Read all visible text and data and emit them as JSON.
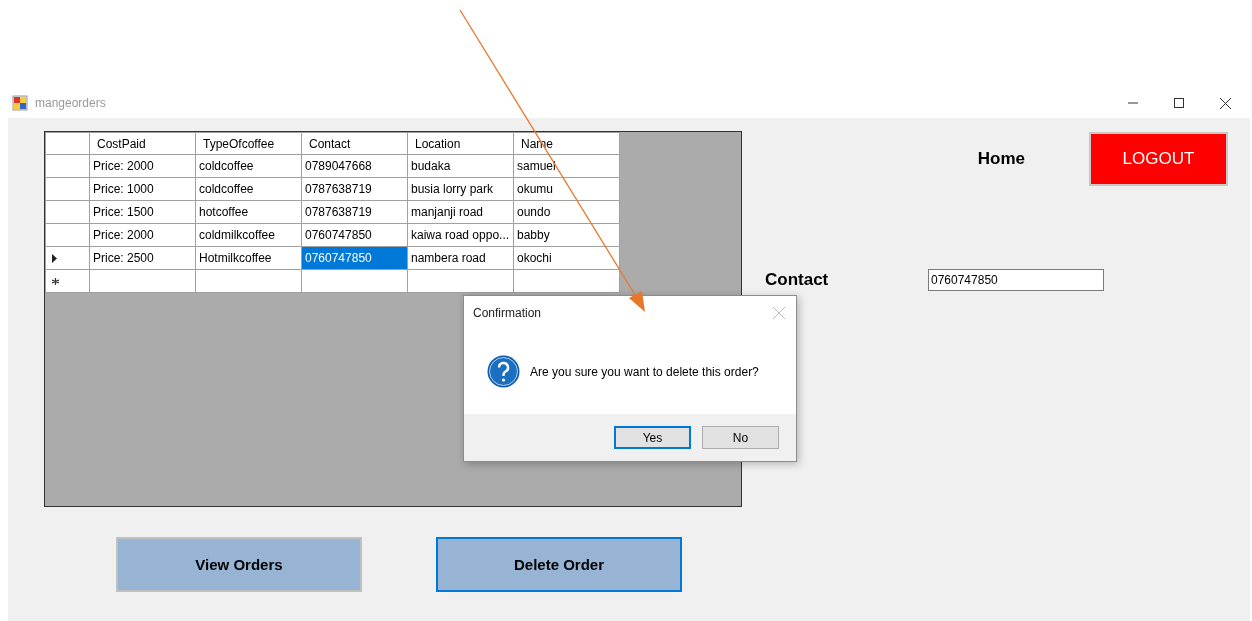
{
  "window": {
    "title": "mangeorders"
  },
  "table": {
    "columns": [
      "CostPaid",
      "TypeOfcoffee",
      "Contact",
      "Location",
      "Name"
    ],
    "rows": [
      {
        "current": false,
        "cells": [
          {
            "text": "Price: 2000",
            "selected": false
          },
          {
            "text": "coldcoffee",
            "selected": false
          },
          {
            "text": "0789047668",
            "selected": false
          },
          {
            "text": "budaka",
            "selected": false
          },
          {
            "text": "samuel",
            "selected": false
          }
        ]
      },
      {
        "current": false,
        "cells": [
          {
            "text": "Price: 1000",
            "selected": false
          },
          {
            "text": "coldcoffee",
            "selected": false
          },
          {
            "text": "0787638719",
            "selected": false
          },
          {
            "text": "busia lorry park",
            "selected": false
          },
          {
            "text": "okumu",
            "selected": false
          }
        ]
      },
      {
        "current": false,
        "cells": [
          {
            "text": "Price: 1500",
            "selected": false
          },
          {
            "text": "hotcoffee",
            "selected": false
          },
          {
            "text": "0787638719",
            "selected": false
          },
          {
            "text": "manjanji road",
            "selected": false
          },
          {
            "text": "oundo",
            "selected": false
          }
        ]
      },
      {
        "current": false,
        "cells": [
          {
            "text": "Price: 2000",
            "selected": false
          },
          {
            "text": "coldmilkcoffee",
            "selected": false
          },
          {
            "text": "0760747850",
            "selected": false
          },
          {
            "text": "kaiwa road oppo...",
            "selected": false
          },
          {
            "text": "babby",
            "selected": false
          }
        ]
      },
      {
        "current": true,
        "cells": [
          {
            "text": "Price: 2500",
            "selected": false
          },
          {
            "text": "Hotmilkcoffee",
            "selected": false
          },
          {
            "text": "0760747850",
            "selected": true
          },
          {
            "text": "nambera road",
            "selected": false
          },
          {
            "text": "okochi",
            "selected": false
          }
        ]
      }
    ],
    "new_row": true
  },
  "home_label": "Home",
  "logout_button": "LOGOUT",
  "contact": {
    "label": "Contact",
    "value": "0760747850"
  },
  "buttons": [
    {
      "label": "View Orders",
      "focused": false
    },
    {
      "label": "Delete Order",
      "focused": true
    }
  ],
  "dialog": {
    "title": "Confirmation",
    "message": "Are you sure you want to delete this order?",
    "buttons": [
      {
        "label": "Yes",
        "default": true
      },
      {
        "label": "No",
        "default": false
      }
    ]
  }
}
